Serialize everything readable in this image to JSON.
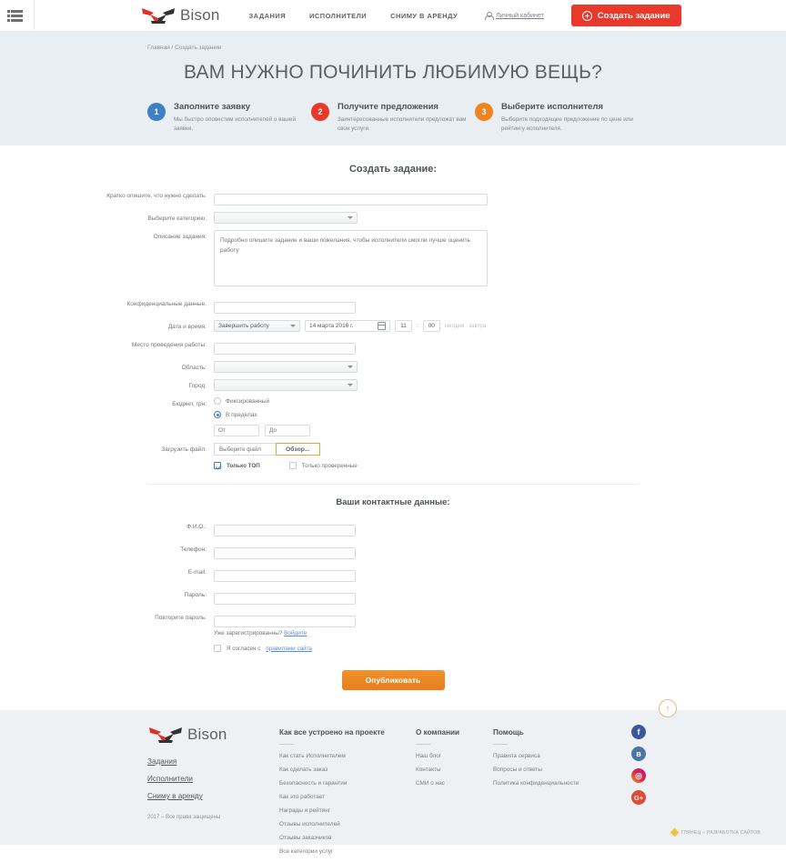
{
  "header": {
    "menu_icon": "hamburger-icon",
    "logo_text": "Bison",
    "nav": [
      {
        "label": "ЗАДАНИЯ"
      },
      {
        "label": "ИСПОЛНИТЕЛИ"
      },
      {
        "label": "СНИМУ В АРЕНДУ"
      }
    ],
    "cabinet_label": "Личный кабинет",
    "create_button": "Создать задание"
  },
  "hero": {
    "breadcrumb": "Главная / Создать задание",
    "title": "ВАМ НУЖНО ПОЧИНИТЬ ЛЮБИМУЮ ВЕЩЬ?",
    "steps": [
      {
        "num": "1",
        "title": "Заполните заявку",
        "text": "Мы быстро оповестим исполнителей о вашей заявке.",
        "color": "#3f7fc4"
      },
      {
        "num": "2",
        "title": "Получите предложения",
        "text": "Заинтересованные исполнители предложат вам свои услуги.",
        "color": "#e8392b"
      },
      {
        "num": "3",
        "title": "Выберите исполнителя",
        "text": "Выберите подходящее предложение по цене или рейтингу исполнителя.",
        "color": "#f08422"
      }
    ]
  },
  "form": {
    "title": "Создать задание:",
    "short_desc_label": "Кратко опишите, что нужно сделать:",
    "short_desc_value": "",
    "category_label": "Выберите категорию:",
    "category_value": "",
    "description_label": "Описание задания:",
    "description_placeholder": "Подробно опишите задание и ваши пожелания, чтобы исполнители смогли лучше оценить работу",
    "confidential_label": "Конфиденциальные данные:",
    "confidential_value": "",
    "datetime_label": "Дата и время:",
    "datetime_mode": "Завершить работу",
    "date_value": "14 марта 2016 г.",
    "hour_value": "11",
    "time_separator": ":",
    "minute_value": "00",
    "today_link": "сегодня",
    "tomorrow_link": "завтра",
    "place_label": "Место проведения работы:",
    "place_value": "",
    "region_label": "Область:",
    "region_value": "",
    "city_label": "Город:",
    "city_value": "",
    "budget_label": "Бюджет, грн:",
    "budget_fixed": "Фиксированный",
    "budget_range": "В пределах",
    "budget_from_placeholder": "От",
    "budget_to_placeholder": "До",
    "upload_label": "Загрузить файл:",
    "file_name": "Выберите файл",
    "browse_button": "Обзор...",
    "only_top": "Только ТОП",
    "only_verified": "Только проверенные"
  },
  "contacts": {
    "title": "Ваши контактные данные:",
    "fields": [
      {
        "label": "Ф.И.О.:",
        "value": ""
      },
      {
        "label": "Телефон:",
        "value": ""
      },
      {
        "label": "E-mail:",
        "value": ""
      },
      {
        "label": "Пароль:",
        "value": ""
      },
      {
        "label": "Повторите пароль:",
        "value": ""
      }
    ],
    "registered_text": "Уже зарегистрированны?",
    "login_link": "Войдите",
    "agree_text": "Я согласен с",
    "agree_link": "правилами сайта",
    "publish_button": "Опубликовать"
  },
  "footer": {
    "logo_text": "Bison",
    "nav": [
      {
        "label": "Задания"
      },
      {
        "label": "Исполнители"
      },
      {
        "label": "Сниму в аренду"
      }
    ],
    "copyright": "2017 – Все права защищены",
    "columns": [
      {
        "title": "Как все устроено на проекте",
        "links": [
          {
            "label": "Как стать Исполнителем"
          },
          {
            "label": "Как сделать заказ"
          },
          {
            "label": "Безопасность и гарантии"
          },
          {
            "label": "Как это работает"
          },
          {
            "label": "Награды и рейтинг"
          },
          {
            "label": "Отзывы исполнителей"
          },
          {
            "label": "Отзывы заказчиков"
          },
          {
            "label": "Все категории услуг"
          }
        ]
      },
      {
        "title": "О компании",
        "links": [
          {
            "label": "Наш блог"
          },
          {
            "label": "Контакты"
          },
          {
            "label": "СМИ о нас"
          }
        ]
      },
      {
        "title": "Помощь",
        "links": [
          {
            "label": "Правила сервиса"
          },
          {
            "label": "Вопросы и ответы"
          },
          {
            "label": "Политика конфиденциальности"
          }
        ]
      }
    ],
    "socials": [
      {
        "name": "facebook-icon",
        "glyph": "f"
      },
      {
        "name": "vk-icon",
        "glyph": "в"
      },
      {
        "name": "instagram-icon",
        "glyph": "◎"
      },
      {
        "name": "googleplus-icon",
        "glyph": "G+"
      }
    ],
    "scroll_top_glyph": "↑",
    "credit": "ГЛЯНЕЦ – РАЗРАБОТКА САЙТОВ"
  }
}
